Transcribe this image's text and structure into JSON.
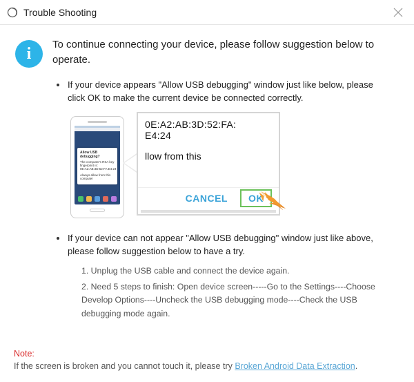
{
  "titlebar": {
    "title": "Trouble Shooting"
  },
  "intro": "To continue connecting your device, please follow suggestion below to operate.",
  "bullets": {
    "b1": "If your device appears \"Allow USB debugging\" window just like below, please click OK to make the current device  be connected correctly.",
    "b2": "If your device can not appear \"Allow USB debugging\" window just like above, please follow suggestion below to have a try."
  },
  "illustration": {
    "mac_line1": "0E:A2:AB:3D:52:FA:",
    "mac_line2": "E4:24",
    "sub": "llow from this",
    "cancel": "CANCEL",
    "ok": "OK",
    "phone_dialog": {
      "title": "Allow USB debugging?",
      "body1": "The computer's RSA key fingerprint is:",
      "body2": "0E:A2:AB:3D:52:FA:E4:24",
      "body3": "Always allow from this computer"
    }
  },
  "steps": {
    "s1": "1. Unplug the USB cable and connect the device again.",
    "s2": "2. Need 5 steps to finish: Open device screen-----Go to the Settings----Choose Develop Options----Uncheck the USB debugging mode----Check the USB debugging mode again."
  },
  "footer": {
    "note_label": "Note:",
    "note_body": "If the screen is broken and you cannot touch it, please try ",
    "note_link": "Broken Android Data Extraction",
    "note_period": "."
  }
}
